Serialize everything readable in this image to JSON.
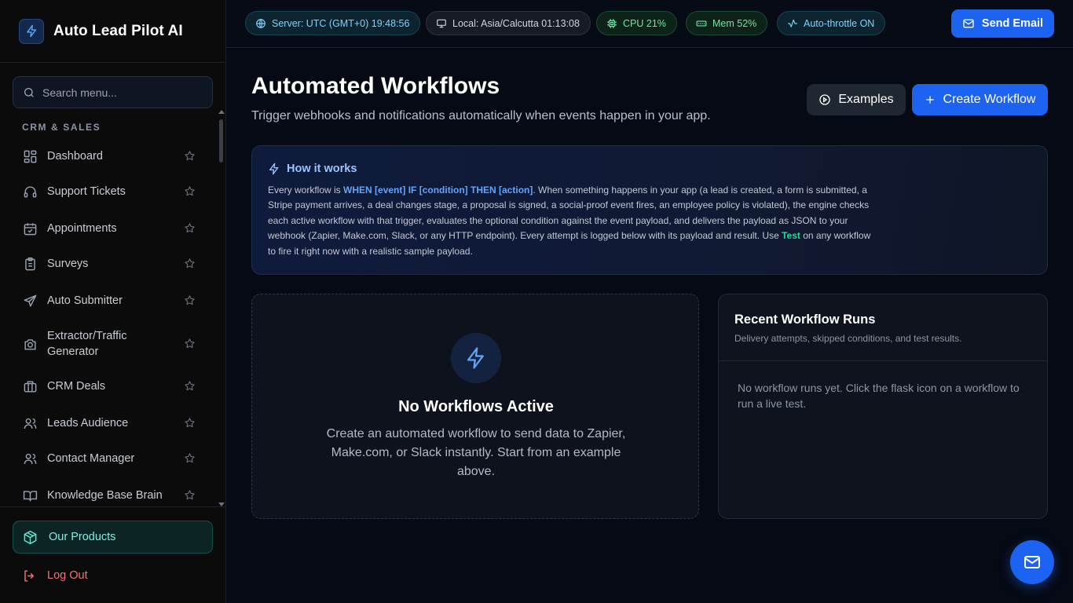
{
  "app": {
    "name": "Auto Lead Pilot AI"
  },
  "search": {
    "placeholder": "Search menu..."
  },
  "sidebar": {
    "section_label": "CRM & SALES",
    "items": [
      {
        "label": "Dashboard",
        "icon": "layout-grid-icon"
      },
      {
        "label": "Support Tickets",
        "icon": "headset-icon"
      },
      {
        "label": "Appointments",
        "icon": "calendar-check-icon"
      },
      {
        "label": "Surveys",
        "icon": "clipboard-list-icon"
      },
      {
        "label": "Auto Submitter",
        "icon": "send-icon"
      },
      {
        "label": "Extractor/Traffic Generator",
        "icon": "camera-icon"
      },
      {
        "label": "CRM Deals",
        "icon": "briefcase-icon"
      },
      {
        "label": "Leads Audience",
        "icon": "users-icon"
      },
      {
        "label": "Contact Manager",
        "icon": "contact-users-icon"
      },
      {
        "label": "Knowledge Base Brain",
        "icon": "book-open-icon"
      }
    ],
    "footer": {
      "products_label": "Our Products",
      "logout_label": "Log Out"
    }
  },
  "topbar": {
    "server": "Server: UTC (GMT+0) 19:48:56",
    "local": "Local: Asia/Calcutta 01:13:08",
    "cpu": "CPU 21%",
    "mem": "Mem 52%",
    "throttle": "Auto-throttle ON",
    "send_email": "Send Email"
  },
  "main": {
    "title": "Automated Workflows",
    "subtitle": "Trigger webhooks and notifications automatically when events happen in your app.",
    "examples_label": "Examples",
    "create_label": "Create Workflow",
    "how": {
      "title": "How it works",
      "p1": "Every workflow is ",
      "rule": "WHEN [event] IF [condition] THEN [action]",
      "p2": ". When something happens in your app (a lead is created, a form is submitted, a Stripe payment arrives, a deal changes stage, a proposal is signed, a social-proof event fires, an employee policy is violated), the engine checks each active workflow with that trigger, evaluates the optional condition against the event payload, and delivers the payload as JSON to your webhook (Zapier, Make.com, Slack, or any HTTP endpoint). Every attempt is logged below with its payload and result. Use ",
      "test_word": "Test",
      "p3": " on any workflow to fire it right now with a realistic sample payload."
    },
    "empty": {
      "title": "No Workflows Active",
      "text": "Create an automated workflow to send data to Zapier, Make.com, or Slack instantly. Start from an example above."
    },
    "runs": {
      "title": "Recent Workflow Runs",
      "subtitle": "Delivery attempts, skipped conditions, and test results.",
      "empty": "No workflow runs yet. Click the flask icon on a workflow to run a live test."
    }
  },
  "colors": {
    "accent": "#1d63f2",
    "teal": "#5eead4",
    "danger": "#f87171",
    "success": "#34d399"
  }
}
